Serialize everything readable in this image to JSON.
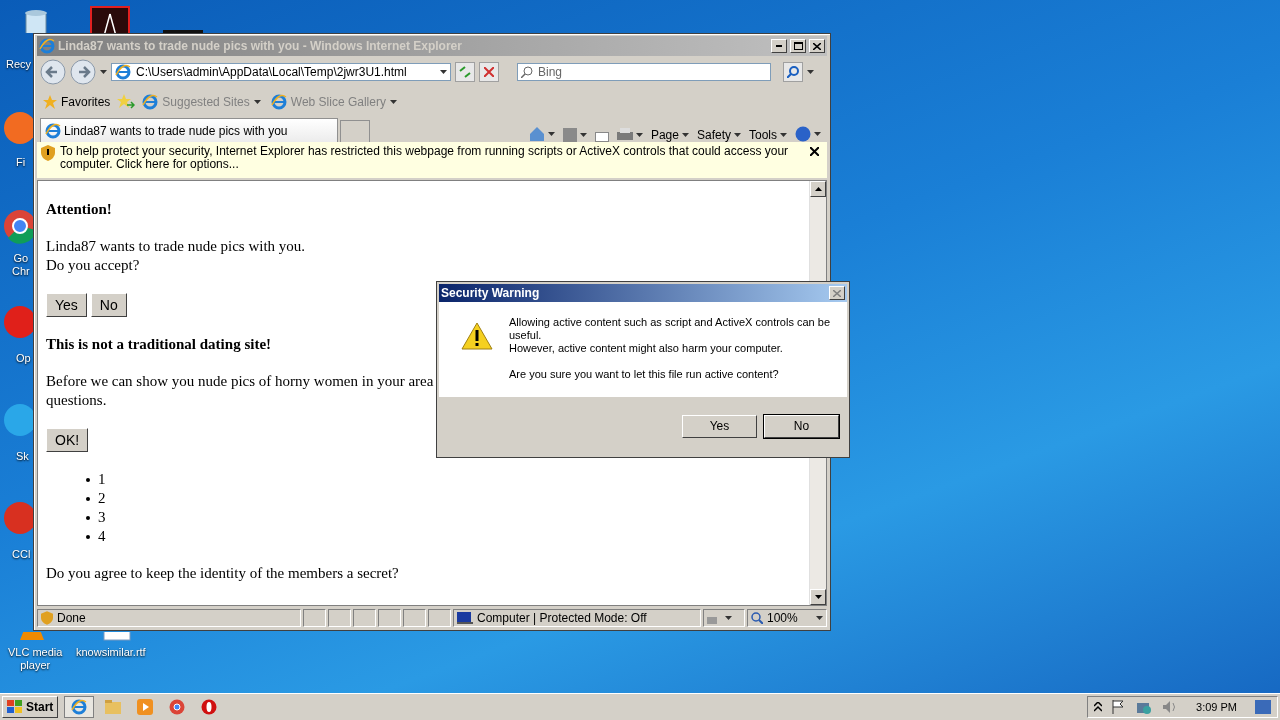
{
  "desktop": {
    "icons": [
      {
        "kind": "recycle",
        "label": "Recy"
      },
      {
        "kind": "acrobat"
      },
      {
        "kind": "dark"
      },
      {
        "kind": "firefox",
        "label": "Fi"
      },
      {
        "kind": "chrome",
        "label": "Go\nChr"
      },
      {
        "kind": "opera",
        "label": "Op"
      },
      {
        "kind": "skype",
        "label": "Sk"
      },
      {
        "kind": "ccleaner",
        "label": "CCl"
      },
      {
        "kind": "vlc",
        "label": "VLC media\nplayer"
      },
      {
        "kind": "document",
        "label": "knowsimilar.rtf"
      }
    ]
  },
  "browser": {
    "title": "Linda87 wants to trade nude pics with you - Windows Internet Explorer",
    "address": "C:\\Users\\admin\\AppData\\Local\\Temp\\2jwr3U1.html",
    "search": {
      "placeholder": "Bing"
    },
    "favorites": {
      "label": "Favorites",
      "links": [
        "Suggested Sites",
        "Web Slice Gallery"
      ]
    },
    "tabs": [
      {
        "label": "Linda87 wants to trade nude pics with you",
        "selected": true
      }
    ],
    "commands": [
      "Page",
      "Safety",
      "Tools"
    ],
    "info_bar": "To help protect your security, Internet Explorer has restricted this webpage from running scripts or ActiveX controls that could access your computer. Click here for options...",
    "page": [
      {
        "kind": "heading",
        "text": "Attention!"
      },
      {
        "kind": "paragraph",
        "lines": [
          "Linda87 wants to trade nude pics with you.",
          "Do you accept?"
        ]
      },
      {
        "kind": "buttons",
        "buttons": [
          "Yes",
          "No"
        ]
      },
      {
        "kind": "heading",
        "text": "This is not a traditional dating site!"
      },
      {
        "kind": "paragraph",
        "lines": [
          "Before we can show you nude pics of horny women in your area",
          "questions."
        ]
      },
      {
        "kind": "buttons",
        "buttons": [
          "OK!"
        ]
      },
      {
        "kind": "list",
        "items": [
          "1",
          "2",
          "3",
          "4"
        ]
      },
      {
        "kind": "paragraph",
        "lines": [
          "Do you agree to keep the identity of the members a secret?"
        ]
      }
    ],
    "status": {
      "text": "Done",
      "zone": "Computer | Protected Mode: Off",
      "zoom": "100%"
    }
  },
  "dialog": {
    "title": "Security Warning",
    "message": [
      "Allowing active content such as script and ActiveX controls can be useful.",
      "However, active content might also harm your computer."
    ],
    "question": "Are you sure you want to let this file run active content?",
    "buttons": [
      {
        "label": "Yes",
        "default": false
      },
      {
        "label": "No",
        "default": true
      }
    ]
  },
  "taskbar": {
    "start": "Start",
    "apps": [
      {
        "kind": "ie",
        "selected": true
      },
      {
        "kind": "folder",
        "selected": false
      },
      {
        "kind": "media",
        "selected": false
      },
      {
        "kind": "chrome",
        "selected": false
      },
      {
        "kind": "opera",
        "selected": false
      }
    ],
    "clock": "3:09 PM"
  }
}
